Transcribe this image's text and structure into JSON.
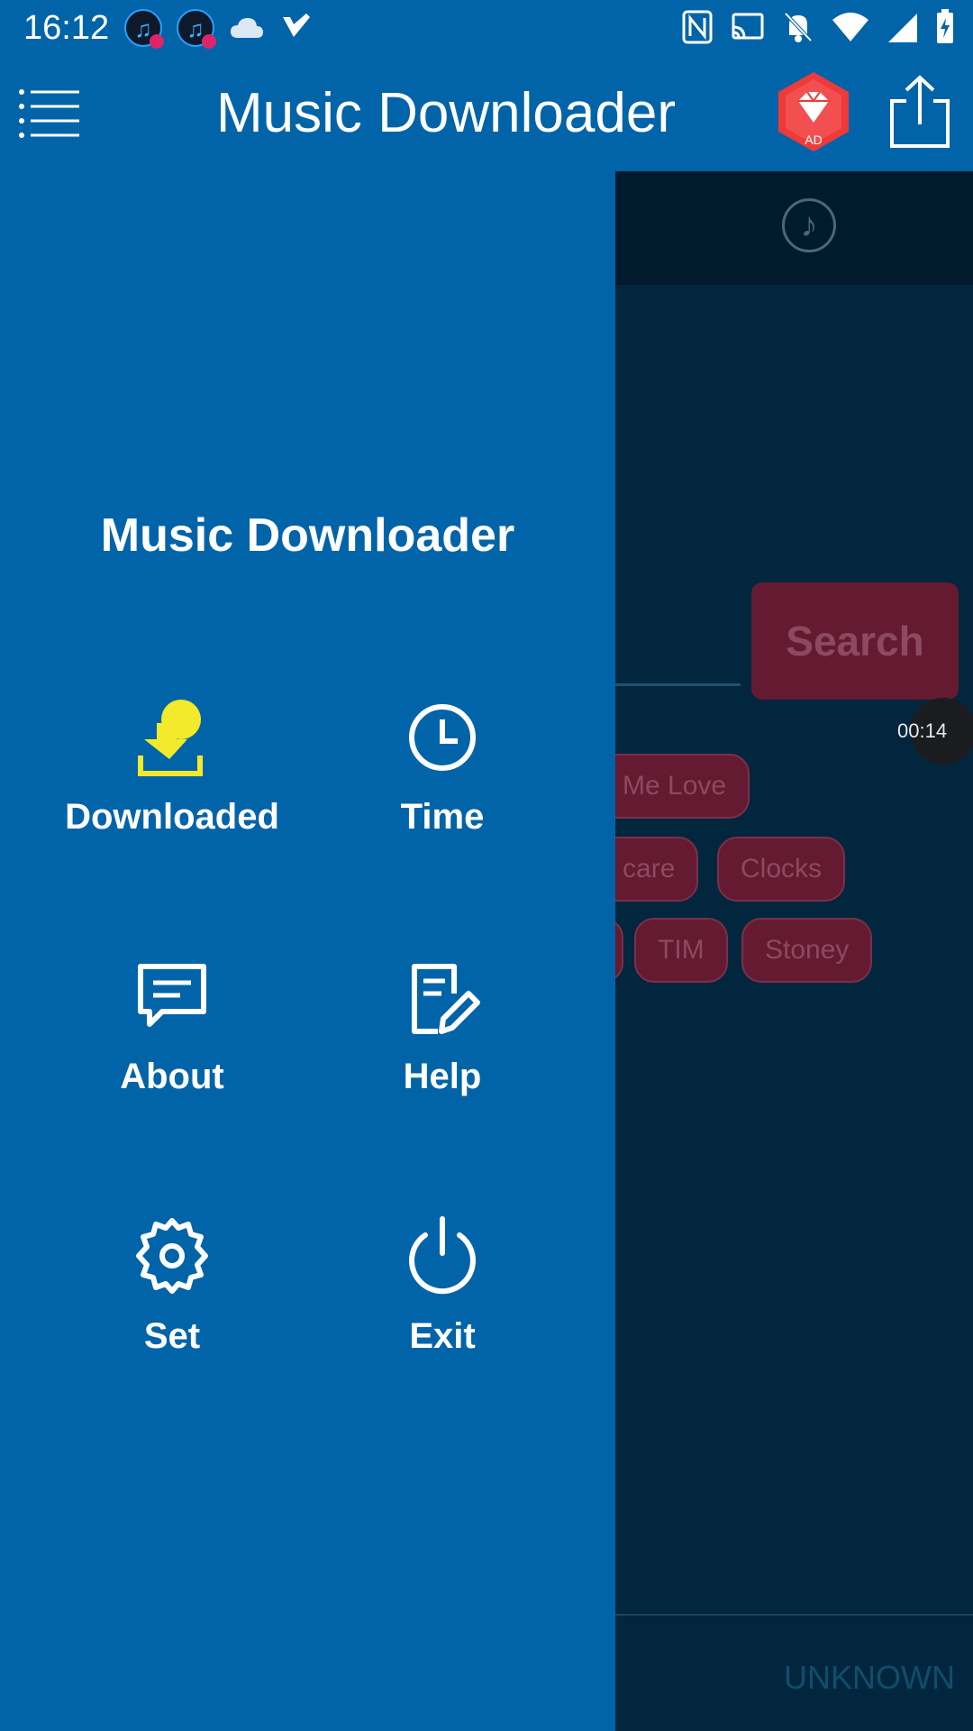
{
  "status_bar": {
    "time": "16:12"
  },
  "app_bar": {
    "title": "Music Downloader",
    "premium_badge": "AD"
  },
  "background": {
    "search_button": "Search",
    "timer": "00:14",
    "chips": [
      "e Me Love",
      "e care",
      "Clocks",
      "TIM",
      "Stoney"
    ],
    "footer_text": "UNKNOWN"
  },
  "drawer": {
    "title": "Music Downloader",
    "items": [
      {
        "label": "Downloaded",
        "icon": "download-icon",
        "color": "#f2ea2a"
      },
      {
        "label": "Time",
        "icon": "clock-icon"
      },
      {
        "label": "About",
        "icon": "chat-icon"
      },
      {
        "label": "Help",
        "icon": "edit-document-icon"
      },
      {
        "label": "Set",
        "icon": "gear-icon"
      },
      {
        "label": "Exit",
        "icon": "power-icon"
      }
    ]
  },
  "colors": {
    "primary": "#0264a8",
    "overlay_bg": "#03263f",
    "accent_chip": "#641a31"
  }
}
